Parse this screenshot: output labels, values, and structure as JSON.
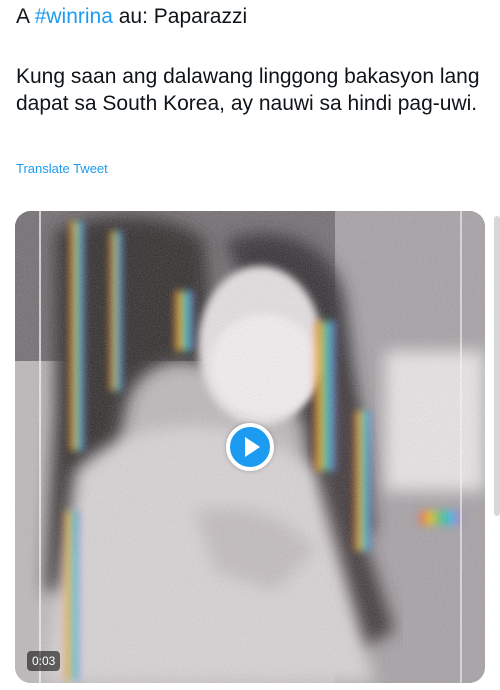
{
  "tweet": {
    "prefix": "A ",
    "hashtag": "#winrina",
    "suffix": " au: Paparazzi",
    "body": "Kung saan ang dalawang linggong bakasyon lang dapat sa South Korea, ay nauwi sa hindi pag-uwi.",
    "translate_label": "Translate Tweet"
  },
  "media": {
    "type": "video",
    "duration": "0:03",
    "play_icon": "play-icon"
  },
  "colors": {
    "accent": "#1d9bf0",
    "text": "#0f1419"
  }
}
